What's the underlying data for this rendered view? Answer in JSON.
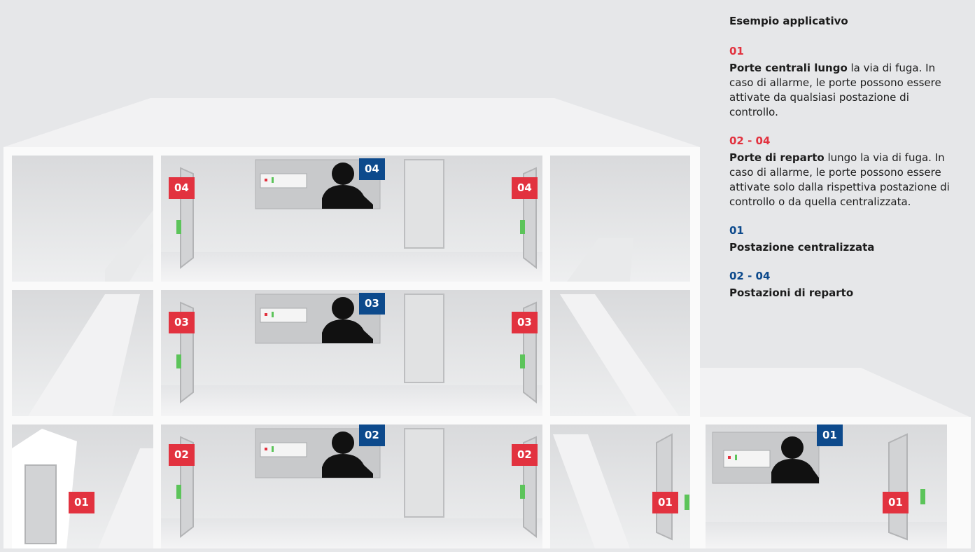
{
  "legend": {
    "title": "Esempio applicativo",
    "items": [
      {
        "code": "01",
        "color": "red",
        "bold": "Porte centrali lungo",
        "text": " la via di fuga. In caso di allarme, le porte possono essere attivate da qualsiasi postazione di controllo."
      },
      {
        "code": "02 - 04",
        "color": "red",
        "bold": "Porte di reparto",
        "text": " lungo la via di fuga. In caso di allarme, le porte possono essere attivate solo dalla rispettiva postazione di controllo o da quella centralizzata."
      },
      {
        "code": "01",
        "color": "blue",
        "bold": "Postazione centralizzata",
        "text": ""
      },
      {
        "code": "02 - 04",
        "color": "blue",
        "bold": "Postazioni di reparto",
        "text": ""
      }
    ]
  },
  "badges": {
    "door_04_left": "04",
    "door_04_right": "04",
    "station_04": "04",
    "door_03_left": "03",
    "door_03_right": "03",
    "station_03": "03",
    "door_02_left": "02",
    "door_02_right": "02",
    "station_02": "02",
    "door_01_a": "01",
    "door_01_b": "01",
    "door_01_c": "01",
    "station_01": "01"
  },
  "colors": {
    "red": "#e2323f",
    "blue": "#0d4a8c",
    "text": "#1c1c1c"
  }
}
